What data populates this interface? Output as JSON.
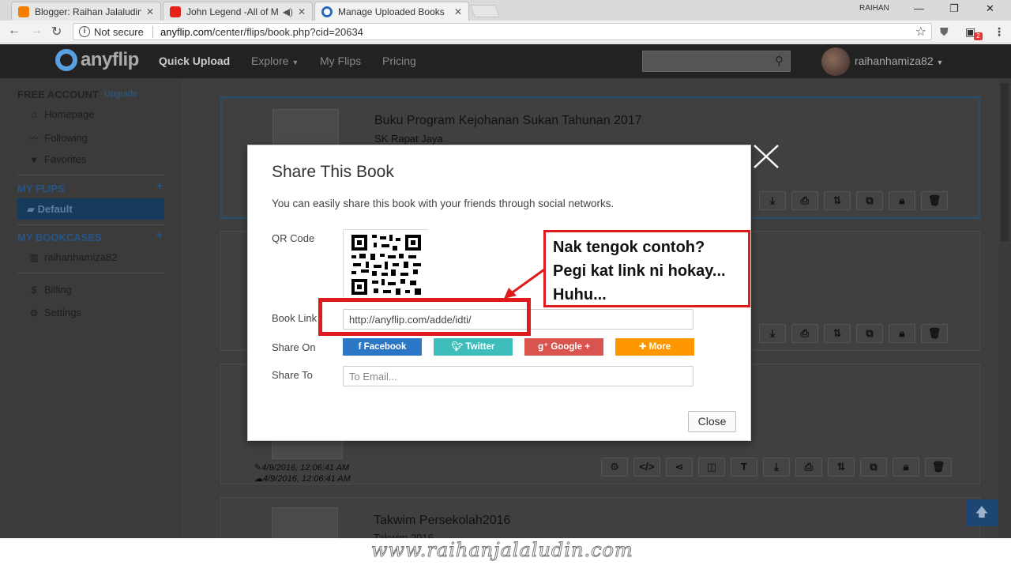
{
  "browser": {
    "tabs": [
      {
        "title": "Blogger: Raihan Jalaludin",
        "favicon_color": "#f57d00"
      },
      {
        "title": "John Legend -All of Me",
        "favicon_color": "#e62117"
      },
      {
        "title": "Manage Uploaded Books",
        "favicon_color": "#2a6bbd"
      }
    ],
    "window_user": "RAIHAN",
    "security_label": "Not secure",
    "url_domain": "anyflip.com",
    "url_path": "/center/flips/book.php?cid=20634",
    "notification_count": "2"
  },
  "site": {
    "brand": "anyflip",
    "nav": [
      "Quick Upload",
      "Explore",
      "My Flips",
      "Pricing"
    ],
    "username": "raihanhamiza82"
  },
  "sidebar": {
    "account_label": "FREE ACCOUNT",
    "upgrade_label": "Upgrade",
    "items": [
      {
        "label": "Homepage",
        "icon": "home-icon"
      },
      {
        "label": "Following",
        "icon": "rss-icon"
      },
      {
        "label": "Favorites",
        "icon": "heart-icon"
      }
    ],
    "my_flips_label": "MY FLIPS",
    "default_label": "Default",
    "my_bookcases_label": "MY BOOKCASES",
    "bookcase_user": "raihanhamiza82",
    "billing_label": "Billing",
    "settings_label": "Settings"
  },
  "books": [
    {
      "title": "Buku Program Kejohanan Sukan Tahunan 2017",
      "subtitle": "SK Rapat Jaya"
    },
    {
      "title": "Takwim Persekolah2016",
      "subtitle": "Takwim 2016"
    }
  ],
  "book_dates": [
    "4/9/2016, 12:06:41 AM",
    "4/9/2016, 12:06:41 AM"
  ],
  "modal": {
    "title": "Share This Book",
    "description": "You can easily share this book with your friends through social networks.",
    "qr_label": "QR Code",
    "link_label": "Book Link",
    "link_value": "http://anyflip.com/adde/idti/",
    "share_on_label": "Share On",
    "share_buttons": [
      {
        "label": "Facebook",
        "icon": "facebook-icon",
        "color": "#2b77c5"
      },
      {
        "label": "Twitter",
        "icon": "twitter-icon",
        "color": "#3fbdba"
      },
      {
        "label": "Google +",
        "icon": "google-plus-icon",
        "color": "#d9534f"
      },
      {
        "label": "More",
        "icon": "plus-icon",
        "color": "#ff9800"
      }
    ],
    "share_to_label": "Share To",
    "email_placeholder": "To Email...",
    "close_label": "Close"
  },
  "annotation": {
    "lines": [
      "Nak tengok contoh?",
      "Pegi kat link ni hokay...",
      "Huhu..."
    ],
    "color": "#e01b1b"
  },
  "watermark": "www.raihanjalaludin.com"
}
